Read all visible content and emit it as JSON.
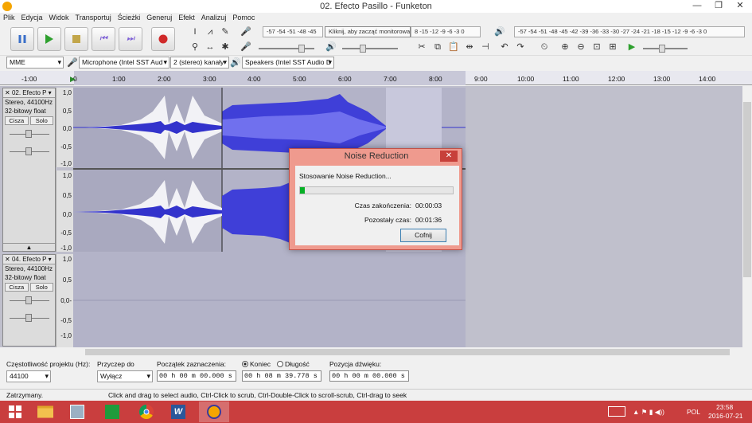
{
  "window": {
    "title": "02. Efecto Pasillo - Funketon",
    "min": "—",
    "max": "❐",
    "close": "✕"
  },
  "menu": [
    "Plik",
    "Edycja",
    "Widok",
    "Transportuj",
    "Ścieżki",
    "Generuj",
    "Efekt",
    "Analizuj",
    "Pomoc"
  ],
  "toolbar": {
    "rec_meter_scale": "-57 -54 -51 -48 -45",
    "monitor_label": "Kliknij, aby zacząć monitorować",
    "rec_meter_right": "8 -15 -12 -9 -6 -3 0",
    "play_meter_scale": "-57 -54 -51 -48 -45 -42 -39 -36 -33 -30 -27 -24 -21 -18 -15 -12 -9 -6 -3 0",
    "lr_label": "L R"
  },
  "devices": {
    "host": "MME",
    "mic": "Microphone (Intel SST Aud",
    "channels": "2 (stereo) kanały",
    "speakers": "Speakers (Intel SST Audio D"
  },
  "ruler": [
    "-1:00",
    "0",
    "1:00",
    "2:00",
    "3:00",
    "4:00",
    "5:00",
    "6:00",
    "7:00",
    "8:00",
    "9:00",
    "10:00",
    "11:00",
    "12:00",
    "13:00",
    "14:00"
  ],
  "tracks": [
    {
      "name": "02. Efecto P",
      "rate": "Stereo, 44100Hz",
      "fmt": "32-bitowy float",
      "mute": "Cisza",
      "solo": "Solo",
      "scale": [
        "1,0",
        "0,5",
        "0,0",
        "-0,5",
        "-1,0"
      ]
    },
    {
      "name": "04. Efecto P",
      "rate": "Stereo, 44100Hz",
      "fmt": "32-bitowy float",
      "mute": "Cisza",
      "solo": "Solo",
      "scale": [
        "1,0",
        "0,5",
        "0,0-",
        "-0,5",
        "-1,0"
      ]
    }
  ],
  "dialog": {
    "title": "Noise Reduction",
    "close": "✕",
    "message": "Stosowanie Noise Reduction...",
    "elapsed_label": "Czas zakończenia:",
    "elapsed_value": "00:00:03",
    "remaining_label": "Pozostały czas:",
    "remaining_value": "00:01:36",
    "cancel": "Cofnij",
    "progress": 0.03
  },
  "selection": {
    "rate_label": "Częstotliwość projektu (Hz):",
    "rate_value": "44100",
    "snap_label": "Przyczep do",
    "snap_value": "Wyłącz",
    "start_label": "Początek zaznaczenia:",
    "start_value": "00 h 00 m 00.000 s",
    "end_label": "Koniec",
    "length_label": "Długość",
    "end_value": "00 h 08 m 39.778 s",
    "pos_label": "Pozycja dźwięku:",
    "pos_value": "00 h 00 m 00.000 s"
  },
  "status": {
    "state": "Zatrzymany.",
    "hint": "Click and drag to select audio, Ctrl-Click to scrub, Ctrl-Double-Click to scroll-scrub, Ctrl-drag to seek"
  },
  "tray": {
    "lang": "POL",
    "time": "23:58",
    "date": "2016-07-21"
  },
  "colors": {
    "wave": "#3333cc",
    "wave_light": "#6a6af0",
    "selection": "#b3b3c8",
    "taskbar": "#c93e3e",
    "progress": "#06b025"
  }
}
